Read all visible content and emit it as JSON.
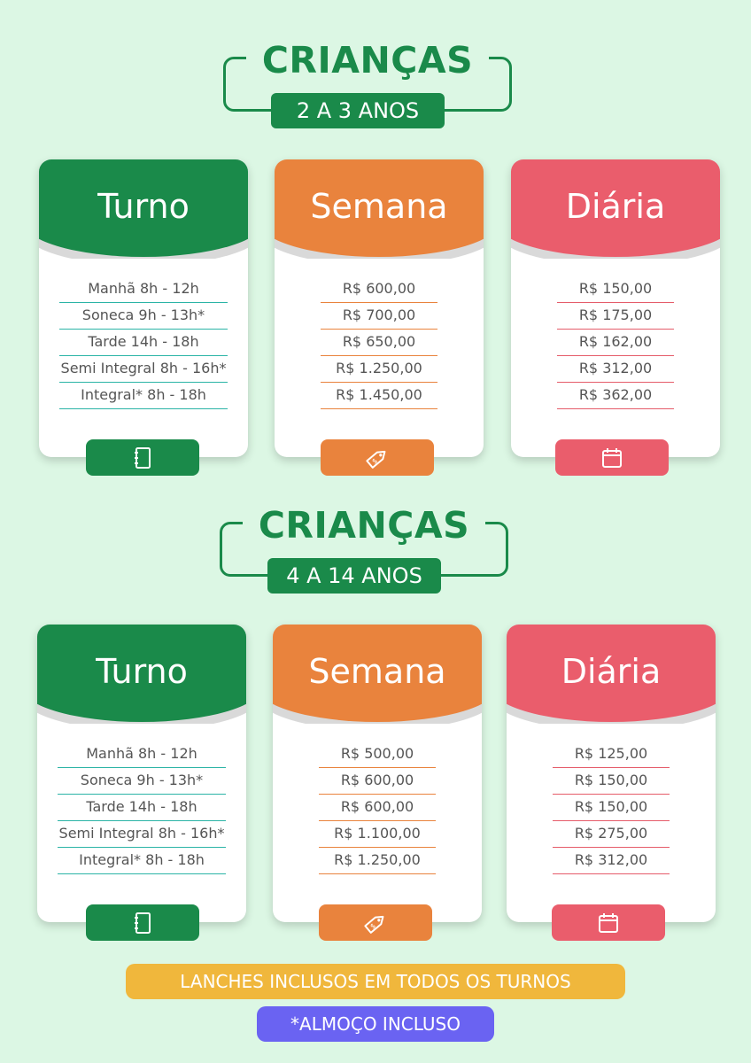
{
  "sections": [
    {
      "title": "CRIANÇAS",
      "age": "2 A 3 ANOS",
      "turno": {
        "label": "Turno",
        "rows": [
          "Manhã 8h - 12h",
          "Soneca 9h - 13h*",
          "Tarde 14h - 18h",
          "Semi Integral 8h - 16h*",
          "Integral* 8h - 18h"
        ],
        "icon": "notebook-icon"
      },
      "semana": {
        "label": "Semana",
        "rows": [
          "R$ 600,00",
          "R$ 700,00",
          "R$ 650,00",
          "R$ 1.250,00",
          "R$ 1.450,00"
        ],
        "icon": "price-tag-icon"
      },
      "diaria": {
        "label": "Diária",
        "rows": [
          "R$ 150,00",
          "R$ 175,00",
          "R$ 162,00",
          "R$ 312,00",
          "R$ 362,00"
        ],
        "icon": "calendar-icon"
      }
    },
    {
      "title": "CRIANÇAS",
      "age": "4 A 14 ANOS",
      "turno": {
        "label": "Turno",
        "rows": [
          "Manhã 8h - 12h",
          "Soneca 9h - 13h*",
          "Tarde 14h - 18h",
          "Semi Integral 8h - 16h*",
          "Integral* 8h - 18h"
        ],
        "icon": "notebook-icon"
      },
      "semana": {
        "label": "Semana",
        "rows": [
          "R$ 500,00",
          "R$ 600,00",
          "R$ 600,00",
          "R$ 1.100,00",
          "R$ 1.250,00"
        ],
        "icon": "price-tag-icon"
      },
      "diaria": {
        "label": "Diária",
        "rows": [
          "R$ 125,00",
          "R$ 150,00",
          "R$ 150,00",
          "R$ 275,00",
          "R$ 312,00"
        ],
        "icon": "calendar-icon"
      }
    }
  ],
  "footer": {
    "snacks": "LANCHES INCLUSOS EM TODOS OS TURNOS",
    "lunch": "*ALMOÇO INCLUSO"
  },
  "colors": {
    "background": "#dcf7e4",
    "green": "#1a8a4a",
    "orange": "#e9833d",
    "red": "#ea5d6c",
    "yellow": "#f0b73c",
    "blue": "#6a63f2"
  }
}
